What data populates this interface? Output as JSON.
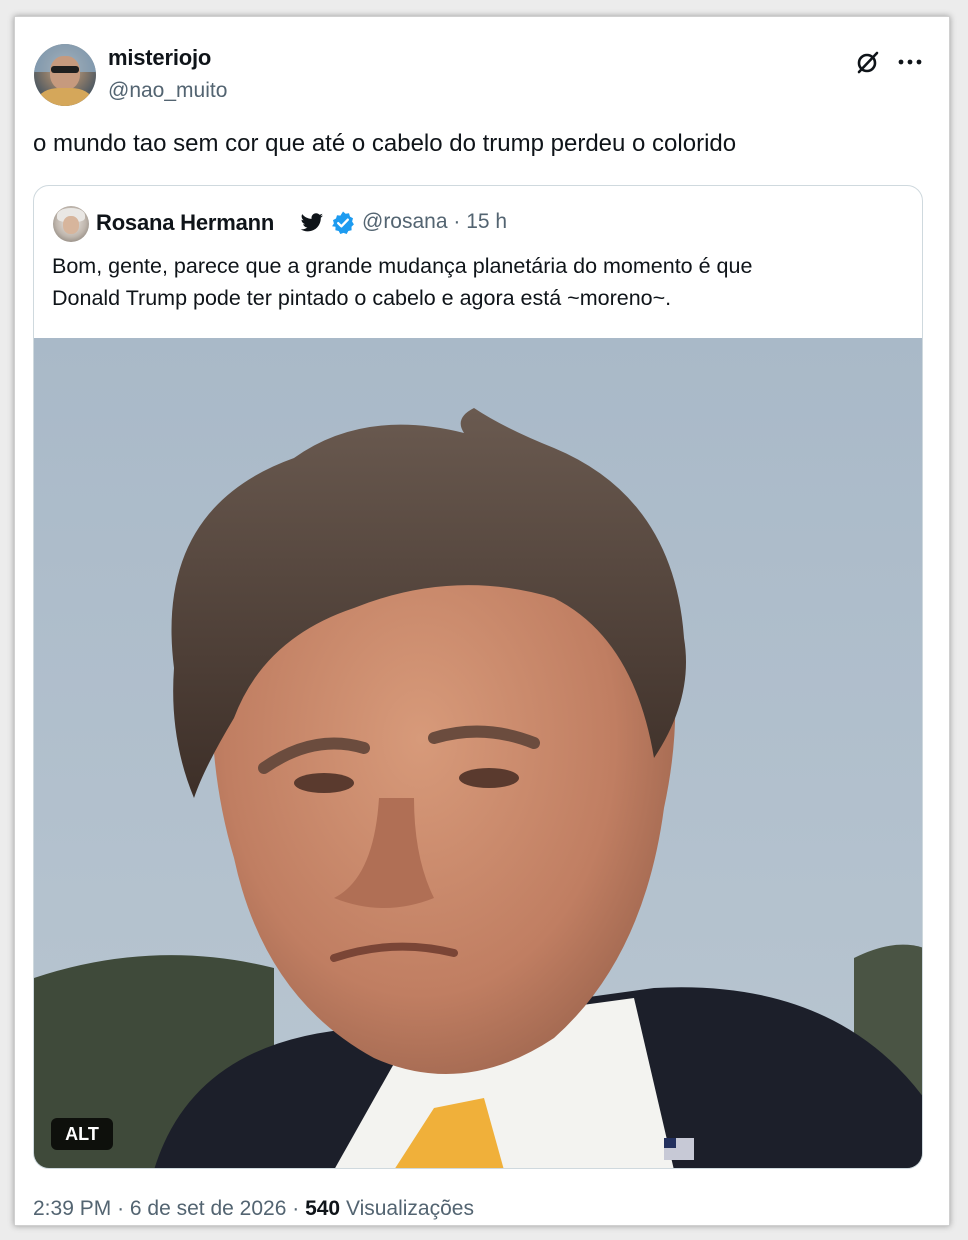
{
  "author": {
    "display_name": "misteriojo",
    "handle": "@nao_muito"
  },
  "tweet": {
    "text": "o mundo tao sem cor que até o cabelo do trump perdeu o colorido"
  },
  "icons": {
    "grok": "grok-icon",
    "more": "more-options-icon",
    "bird": "twitter-bird-icon",
    "verified": "verified-badge-icon"
  },
  "quoted": {
    "display_name": "Rosana Hermann",
    "handle": "@rosana",
    "separator": "·",
    "time": "15 h",
    "text_line1": "Bom, gente, parece que a grande mudança planetária do momento é que",
    "text_line2": "Donald Trump pode ter pintado o cabelo e agora está ~moreno~.",
    "alt_label": "ALT"
  },
  "footer": {
    "time": "2:39 PM",
    "dot1": "·",
    "date": "6 de set de 2026",
    "dot2": "·",
    "views_count": "540",
    "views_label": "Visualizações"
  },
  "colors": {
    "text_primary": "#0f1419",
    "text_secondary": "#536471",
    "verified_blue": "#1d9bf0",
    "border": "#cfd9de",
    "sky": "#a8b8c8",
    "tie": "#f0b03a"
  }
}
